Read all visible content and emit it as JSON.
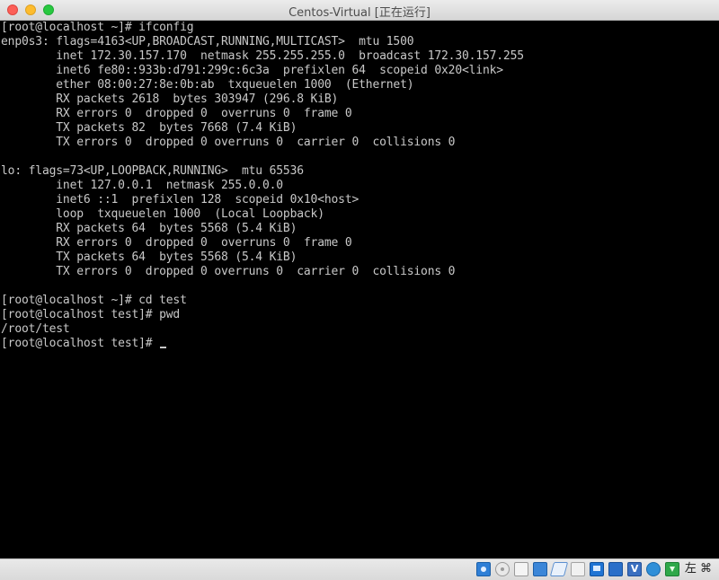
{
  "window": {
    "title": "Centos-Virtual [正在运行]"
  },
  "terminal": {
    "lines": [
      "[root@localhost ~]# ifconfig",
      "enp0s3: flags=4163<UP,BROADCAST,RUNNING,MULTICAST>  mtu 1500",
      "        inet 172.30.157.170  netmask 255.255.255.0  broadcast 172.30.157.255",
      "        inet6 fe80::933b:d791:299c:6c3a  prefixlen 64  scopeid 0x20<link>",
      "        ether 08:00:27:8e:0b:ab  txqueuelen 1000  (Ethernet)",
      "        RX packets 2618  bytes 303947 (296.8 KiB)",
      "        RX errors 0  dropped 0  overruns 0  frame 0",
      "        TX packets 82  bytes 7668 (7.4 KiB)",
      "        TX errors 0  dropped 0 overruns 0  carrier 0  collisions 0",
      "",
      "lo: flags=73<UP,LOOPBACK,RUNNING>  mtu 65536",
      "        inet 127.0.0.1  netmask 255.0.0.0",
      "        inet6 ::1  prefixlen 128  scopeid 0x10<host>",
      "        loop  txqueuelen 1000  (Local Loopback)",
      "        RX packets 64  bytes 5568 (5.4 KiB)",
      "        RX errors 0  dropped 0  overruns 0  frame 0",
      "        TX packets 64  bytes 5568 (5.4 KiB)",
      "        TX errors 0  dropped 0 overruns 0  carrier 0  collisions 0",
      "",
      "[root@localhost ~]# cd test",
      "[root@localhost test]# pwd",
      "/root/test",
      "[root@localhost test]# "
    ],
    "colors": {
      "background": "#000000",
      "text": "#c8c8c8"
    }
  },
  "statusbar": {
    "icons": [
      "hard-disk-icon",
      "optical-drive-icon",
      "audio-icon",
      "network-icon",
      "usb-icon",
      "shared-folders-icon",
      "display-icon",
      "video-capture-icon",
      "virtualbox-icon",
      "cpu-icon",
      "arrow-down-icon"
    ],
    "host_key_label": "左 ⌘"
  }
}
